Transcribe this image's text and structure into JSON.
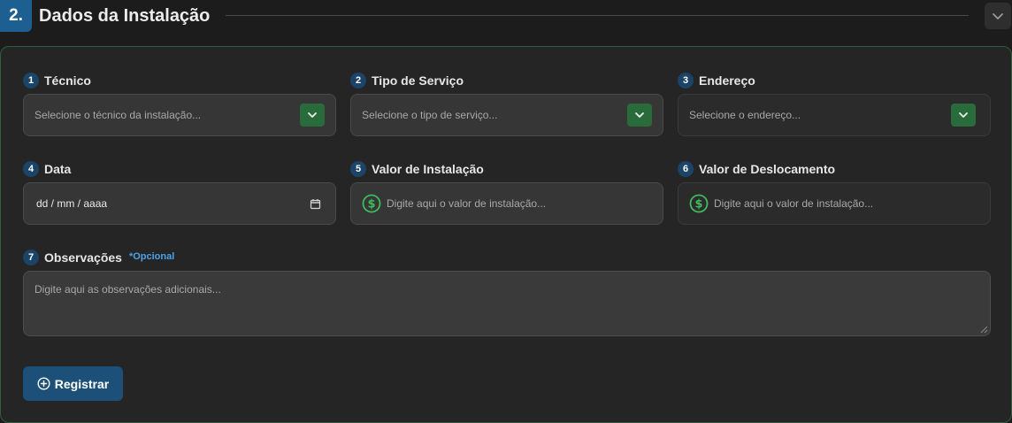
{
  "section": {
    "number": "2.",
    "title": "Dados da Instalação"
  },
  "fields": {
    "tecnico": {
      "number": "1",
      "label": "Técnico",
      "placeholder": "Selecione o técnico da instalação..."
    },
    "tipo_servico": {
      "number": "2",
      "label": "Tipo de Serviço",
      "placeholder": "Selecione o tipo de serviço..."
    },
    "endereco": {
      "number": "3",
      "label": "Endereço",
      "placeholder": "Selecione o endereço..."
    },
    "data": {
      "number": "4",
      "label": "Data",
      "value": "dd / mm / aaaa"
    },
    "valor_instalacao": {
      "number": "5",
      "label": "Valor de Instalação",
      "placeholder": "Digite aqui o valor de instalação..."
    },
    "valor_deslocamento": {
      "number": "6",
      "label": "Valor de Deslocamento",
      "placeholder": "Digite aqui o valor de instalação..."
    },
    "observacoes": {
      "number": "7",
      "label": "Observações",
      "optional": "*Opcional",
      "placeholder": "Digite aqui as observações adicionais..."
    }
  },
  "actions": {
    "register_label": "Registrar"
  },
  "colors": {
    "accent_blue": "#1e5f92",
    "accent_green": "#2a6b3c",
    "optional_blue": "#4aa3e8",
    "money_green": "#3dbb5e"
  },
  "icons": {
    "collapse": "chevron-down-icon",
    "select": "chevron-down-icon",
    "date": "calendar-icon",
    "money": "dollar-circle-icon",
    "register": "plus-circle-icon"
  }
}
